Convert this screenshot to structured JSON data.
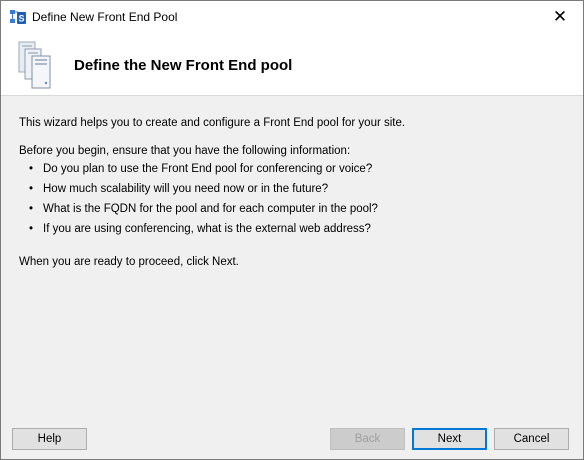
{
  "window": {
    "title": "Define New Front End Pool",
    "close_glyph": "✕"
  },
  "header": {
    "title": "Define the New Front End pool",
    "icon": "server-stack-icon"
  },
  "content": {
    "intro": "This wizard helps you to create and configure a Front End pool for your site.",
    "before": "Before you begin, ensure that you have the following information:",
    "bullets": [
      "Do you plan to use the Front End pool for conferencing or voice?",
      "How much scalability will you need now or in the future?",
      "What is the FQDN for the pool and for each computer in the pool?",
      "If you are using conferencing, what is the external web address?"
    ],
    "proceed": "When you are ready to proceed, click Next."
  },
  "buttons": {
    "help": "Help",
    "back": "Back",
    "next": "Next",
    "cancel": "Cancel"
  }
}
